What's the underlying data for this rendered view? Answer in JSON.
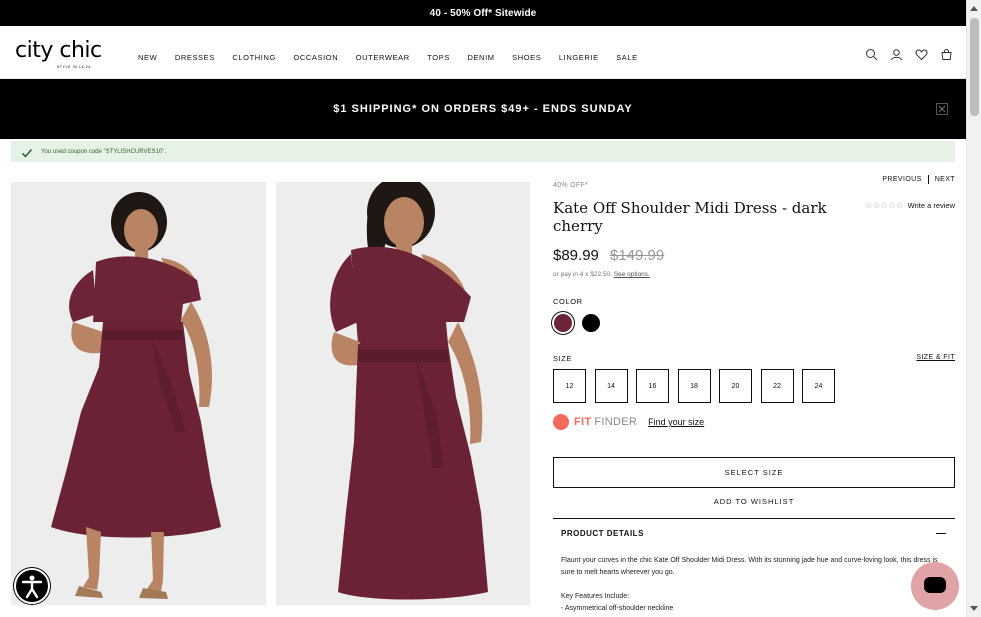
{
  "promo_top": {
    "text": "40 - 50% Off* Sitewide"
  },
  "header": {
    "logo": {
      "text": "city chic",
      "tagline": "STYLE IN 14-24"
    },
    "nav": [
      "NEW",
      "DRESSES",
      "CLOTHING",
      "OCCASION",
      "OUTERWEAR",
      "TOPS",
      "DENIM",
      "SHOES",
      "LINGERIE",
      "SALE"
    ],
    "icons": [
      "search-icon",
      "account-icon",
      "wishlist-heart-icon",
      "bag-icon"
    ],
    "bag_count": "0"
  },
  "shipping_banner": {
    "text": "$1 SHIPPING* ON ORDERS $49+ - ENDS SUNDAY"
  },
  "coupon": {
    "text": "You used coupon code \"STYLISHCURVES10\"."
  },
  "product": {
    "discount": "40% OFF*",
    "prev": "PREVIOUS",
    "next": "NEXT",
    "title": "Kate Off Shoulder Midi Dress - dark cherry",
    "review_link": "Write a review",
    "rating_stars": 0,
    "price": "$89.99",
    "was_price": "$149.99",
    "afterpay_text": "or pay in 4 x $22.50.",
    "afterpay_link": "See options.",
    "color_label": "COLOR",
    "colors": [
      {
        "name": "dark cherry",
        "hex": "#6d2436",
        "selected": true
      },
      {
        "name": "black",
        "hex": "#000000",
        "selected": false
      }
    ],
    "size_label": "SIZE",
    "size_fit_link": "SIZE & FIT",
    "sizes": [
      "12",
      "14",
      "16",
      "18",
      "20",
      "22",
      "24"
    ],
    "fit_finder": {
      "fit": "FIT",
      "finder": "FINDER",
      "link": "Find your size"
    },
    "select_size_button": "SELECT SIZE",
    "wishlist_link": "ADD TO WISHLIST",
    "details_heading": "PRODUCT DETAILS",
    "details_body": "Flaunt your curves in the chic Kate Off Shoulder Midi Dress. With its stunning jade hue and curve-loving look, this dress is sure to melt hearts wherever you go.",
    "features_heading": "Key Features Include:",
    "features": [
      "- Asymmetrical off-shoulder neckline"
    ]
  },
  "colors": {
    "brand_black": "#000000",
    "coupon_bg": "#e6f2e6",
    "coupon_text": "#2d6a2d",
    "fit_finder": "#f36b5c",
    "chat": "#e0a3a6"
  }
}
